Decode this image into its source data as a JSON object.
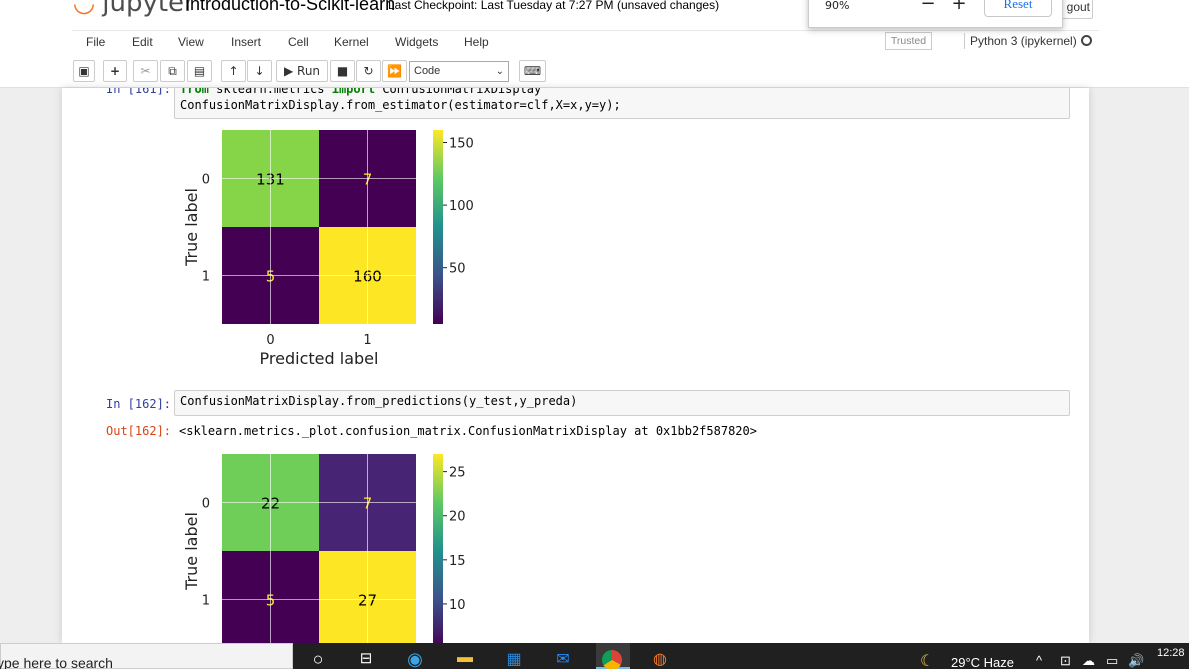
{
  "header": {
    "logo_text": "jupyter",
    "notebook_title": "Introduction-to-Scikit-learn",
    "checkpoint": "Last Checkpoint: Last Tuesday at 7:27 PM",
    "unsaved": "(unsaved changes)",
    "logout": "gout"
  },
  "zoom_popup": {
    "level": "90%",
    "minus": "−",
    "plus": "+",
    "reset": "Reset"
  },
  "menu": [
    "File",
    "Edit",
    "View",
    "Insert",
    "Cell",
    "Kernel",
    "Widgets",
    "Help"
  ],
  "trusted": "Trusted",
  "kernel": "Python 3 (ipykernel)",
  "toolbar": {
    "run_label": "Run",
    "cell_type": "Code"
  },
  "cells": [
    {
      "prompt": "In [161]:",
      "code_line1_kw1": "from",
      "code_line1_mid": " sklearn.metrics ",
      "code_line1_kw2": "import",
      "code_line1_end": " ConfusionMatrixDisplay",
      "code_line2": "ConfusionMatrixDisplay.from_estimator(estimator=clf,X=x,y=y);"
    },
    {
      "prompt": "In [162]:",
      "code": "ConfusionMatrixDisplay.from_predictions(y_test,y_preda)",
      "out_prompt": "Out[162]:",
      "output": "<sklearn.metrics._plot.confusion_matrix.ConfusionMatrixDisplay at 0x1bb2f587820>"
    }
  ],
  "chart_data": [
    {
      "type": "heatmap",
      "colormap": "viridis",
      "xlabel": "Predicted label",
      "ylabel": "True label",
      "x_tick_labels": [
        "0",
        "1"
      ],
      "y_tick_labels": [
        "0",
        "1"
      ],
      "values": [
        [
          131,
          7
        ],
        [
          5,
          160
        ]
      ],
      "cell_colors": [
        [
          "#86d549",
          "#440154"
        ],
        [
          "#440154",
          "#fde725"
        ]
      ],
      "text_colors": [
        [
          "#000000",
          "#fde725"
        ],
        [
          "#fde725",
          "#000000"
        ]
      ],
      "colorbar_ticks": [
        150,
        100,
        50
      ],
      "colorbar_range": [
        5,
        160
      ]
    },
    {
      "type": "heatmap",
      "colormap": "viridis",
      "xlabel": "",
      "ylabel": "True label",
      "x_tick_labels": [],
      "y_tick_labels": [
        "0",
        "1"
      ],
      "values": [
        [
          22,
          7
        ],
        [
          5,
          27
        ]
      ],
      "cell_colors": [
        [
          "#6ece58",
          "#482475"
        ],
        [
          "#440154",
          "#fde725"
        ]
      ],
      "text_colors": [
        [
          "#000000",
          "#fde725"
        ],
        [
          "#fde725",
          "#000000"
        ]
      ],
      "colorbar_ticks": [
        25,
        20,
        15,
        10
      ],
      "colorbar_range": [
        5,
        27
      ]
    }
  ],
  "taskbar": {
    "search_text": "ype here to search",
    "weather": "29°C  Haze",
    "clock": "12:28"
  }
}
